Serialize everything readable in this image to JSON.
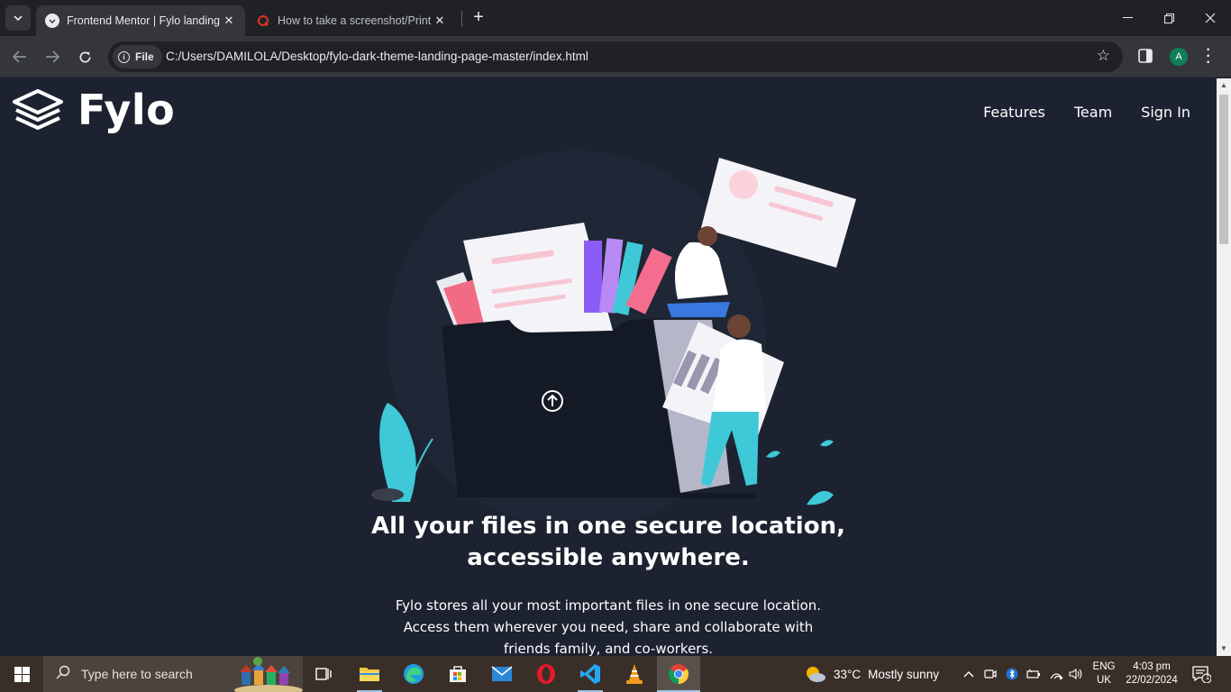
{
  "browser": {
    "tabs": [
      {
        "title": "Frontend Mentor | Fylo landing",
        "active": true
      },
      {
        "title": "How to take a screenshot/Print",
        "active": false
      }
    ],
    "address": {
      "scheme_label": "File",
      "url": "C:/Users/DAMILOLA/Desktop/fylo-dark-theme-landing-page-master/index.html"
    },
    "profile_initial": "A"
  },
  "page": {
    "logo_text": "Fylo",
    "nav": [
      "Features",
      "Team",
      "Sign In"
    ],
    "headline_line1": "All your files in one secure location,",
    "headline_line2": "accessible anywhere.",
    "subtext_line1": "Fylo stores all your most important files in one secure location.",
    "subtext_line2": "Access them wherever you need, share and collaborate with",
    "subtext_line3": "friends family, and co-workers.",
    "colors": {
      "background": "#1c2230",
      "accent_cyan": "#3ec8d8",
      "accent_pink": "#f56d8e"
    }
  },
  "taskbar": {
    "search_placeholder": "Type here to search",
    "weather_temp": "33°C",
    "weather_text": "Mostly sunny",
    "lang_line1": "ENG",
    "lang_line2": "UK",
    "time": "4:03 pm",
    "date": "22/02/2024",
    "notification_count": "1",
    "pinned_apps": [
      "task-view",
      "file-explorer",
      "edge",
      "microsoft-store",
      "mail",
      "opera",
      "vscode",
      "vlc",
      "chrome"
    ]
  }
}
